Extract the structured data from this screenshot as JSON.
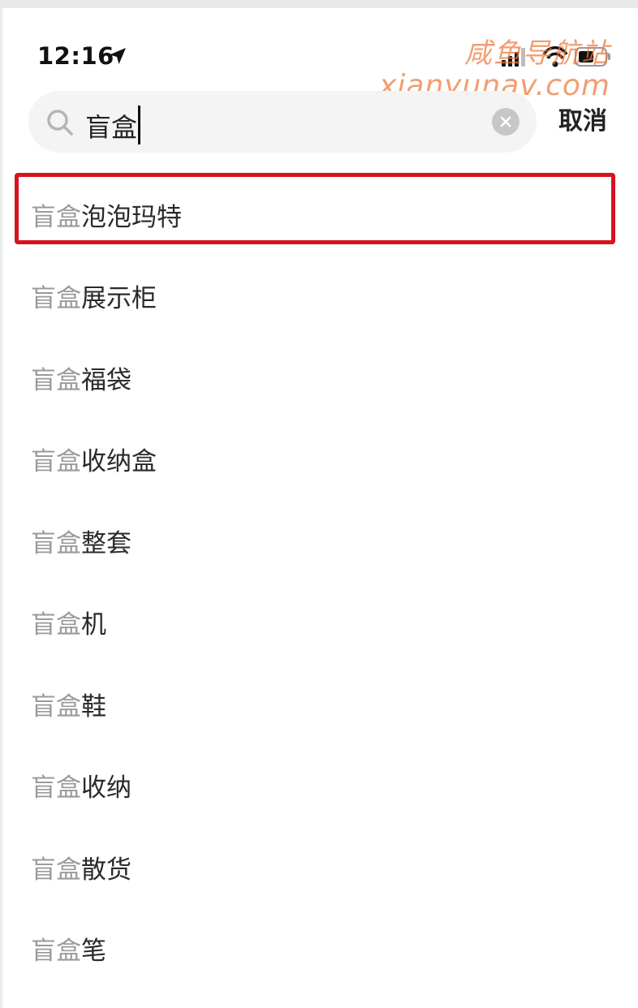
{
  "status_bar": {
    "time": "12:16",
    "location_icon": "location-arrow-icon",
    "icons": [
      "signal-bars-icon",
      "wifi-icon",
      "battery-icon"
    ]
  },
  "watermark": {
    "line1": "咸鱼导航站",
    "line2": "xianyunav.com"
  },
  "search": {
    "query": "盲盒",
    "icon": "search-icon",
    "clear_icon": "clear-circle-icon",
    "cancel_label": "取消"
  },
  "suggestions": [
    {
      "query": "盲盒",
      "rest": "泡泡玛特"
    },
    {
      "query": "盲盒",
      "rest": "展示柜"
    },
    {
      "query": "盲盒",
      "rest": "福袋"
    },
    {
      "query": "盲盒",
      "rest": "收纳盒"
    },
    {
      "query": "盲盒",
      "rest": "整套"
    },
    {
      "query": "盲盒",
      "rest": "机"
    },
    {
      "query": "盲盒",
      "rest": "鞋"
    },
    {
      "query": "盲盒",
      "rest": "收纳"
    },
    {
      "query": "盲盒",
      "rest": "散货"
    },
    {
      "query": "盲盒",
      "rest": "笔"
    }
  ],
  "colors": {
    "highlight_border": "#d8121f",
    "query_text": "#9a9a9a",
    "suggest_text": "#2a2a2a",
    "search_bg": "#f4f4f4",
    "watermark": "#ec783c"
  }
}
